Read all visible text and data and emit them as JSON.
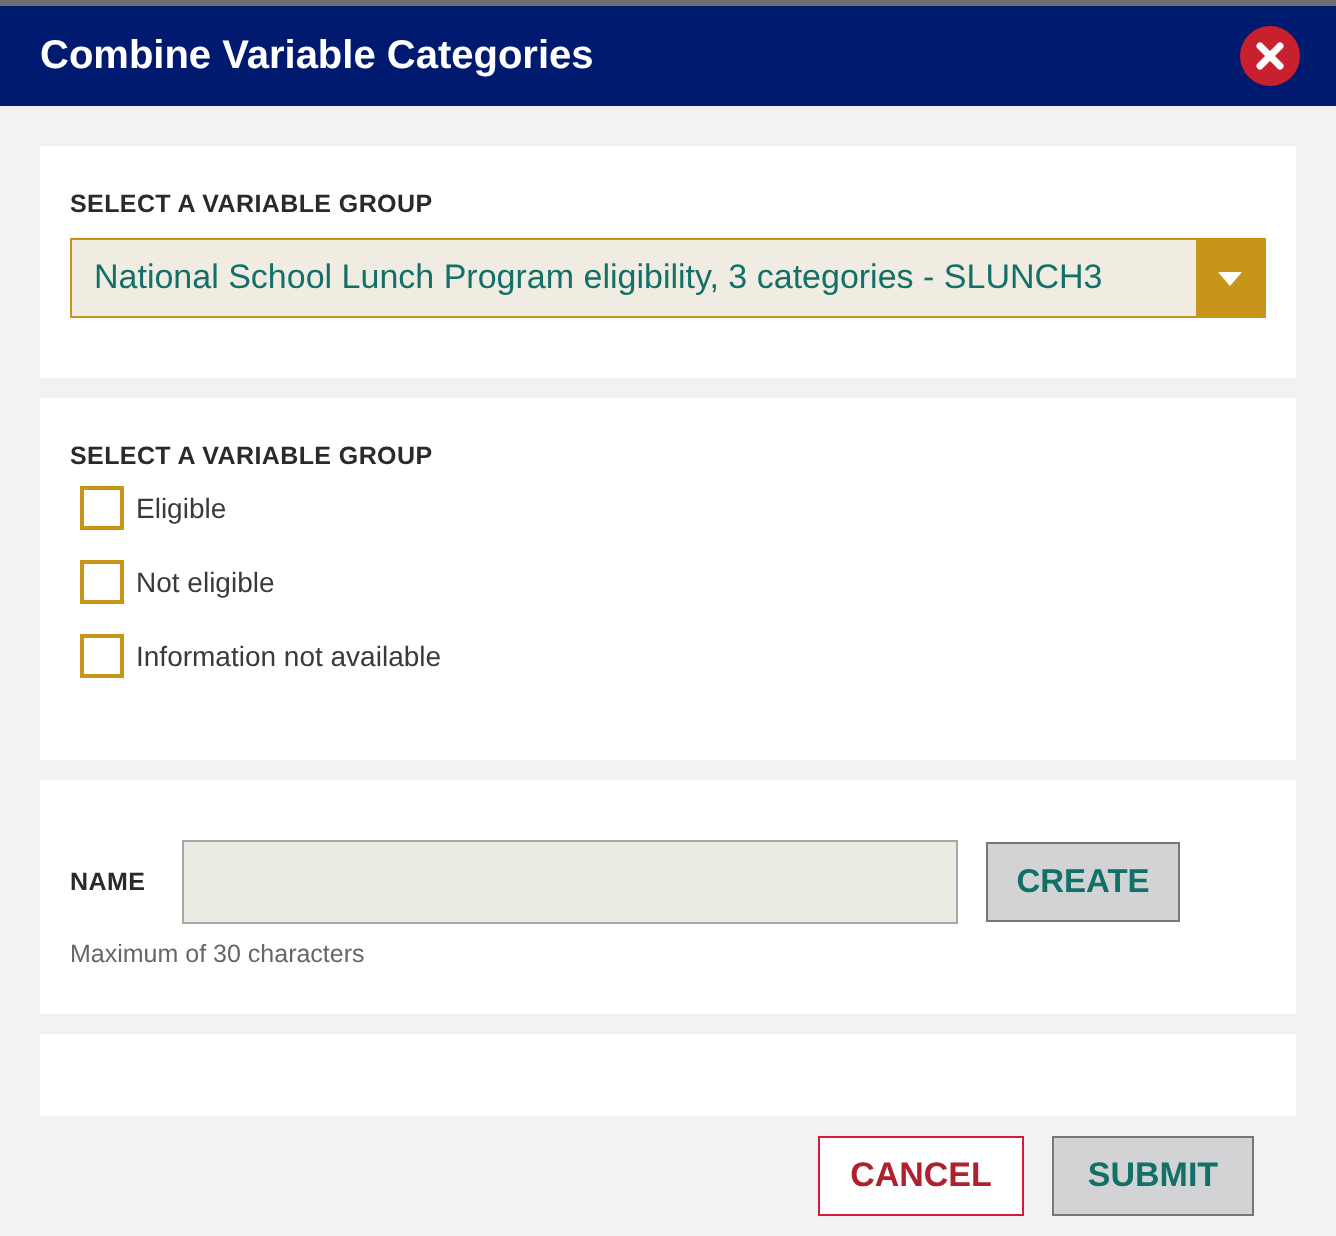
{
  "window": {
    "title": "Combine Variable Categories"
  },
  "group_select": {
    "label": "SELECT A VARIABLE GROUP",
    "value": "National School Lunch Program eligibility, 3 categories - SLUNCH3"
  },
  "categories": {
    "label": "SELECT A VARIABLE GROUP",
    "items": [
      {
        "label": "Eligible",
        "checked": false
      },
      {
        "label": "Not eligible",
        "checked": false
      },
      {
        "label": "Information not available",
        "checked": false
      }
    ]
  },
  "name_field": {
    "label": "NAME",
    "hint": "Maximum of 30 characters",
    "create_button": "CREATE"
  },
  "buttons": {
    "cancel": "CANCEL",
    "submit": "SUBMIT"
  }
}
